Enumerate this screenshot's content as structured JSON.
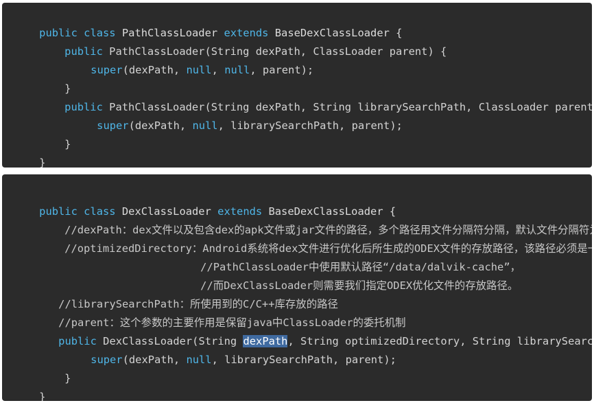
{
  "block1": {
    "lines": [
      {
        "indent": "",
        "parts": [
          {
            "t": "public class ",
            "c": "kw"
          },
          {
            "t": "PathClassLoader ",
            "c": "cls"
          },
          {
            "t": "extends ",
            "c": "kw"
          },
          {
            "t": "BaseDexClassLoader {",
            "c": "cls"
          }
        ]
      },
      {
        "indent": "    ",
        "parts": [
          {
            "t": "public ",
            "c": "kw"
          },
          {
            "t": "PathClassLoader(String dexPath, ClassLoader parent) {",
            "c": "plain"
          }
        ]
      },
      {
        "indent": "        ",
        "parts": [
          {
            "t": "super",
            "c": "kw"
          },
          {
            "t": "(dexPath, ",
            "c": "plain"
          },
          {
            "t": "null",
            "c": "kw"
          },
          {
            "t": ", ",
            "c": "plain"
          },
          {
            "t": "null",
            "c": "kw"
          },
          {
            "t": ", parent);",
            "c": "plain"
          }
        ]
      },
      {
        "indent": "    ",
        "parts": [
          {
            "t": "}",
            "c": "plain"
          }
        ]
      },
      {
        "indent": "    ",
        "parts": [
          {
            "t": "public ",
            "c": "kw"
          },
          {
            "t": "PathClassLoader(String dexPath, String librarySearchPath, ClassLoader parent) {",
            "c": "plain"
          }
        ]
      },
      {
        "indent": "         ",
        "parts": [
          {
            "t": "super",
            "c": "kw"
          },
          {
            "t": "(dexPath, ",
            "c": "plain"
          },
          {
            "t": "null",
            "c": "kw"
          },
          {
            "t": ", librarySearchPath, parent);",
            "c": "plain"
          }
        ]
      },
      {
        "indent": "    ",
        "parts": [
          {
            "t": "}",
            "c": "plain"
          }
        ]
      },
      {
        "indent": "",
        "parts": [
          {
            "t": "}",
            "c": "plain"
          }
        ]
      }
    ]
  },
  "block2": {
    "lines": [
      {
        "indent": "",
        "parts": [
          {
            "t": "public class ",
            "c": "kw"
          },
          {
            "t": "DexClassLoader ",
            "c": "cls"
          },
          {
            "t": "extends ",
            "c": "kw"
          },
          {
            "t": "BaseDexClassLoader {",
            "c": "cls"
          }
        ]
      },
      {
        "indent": "    ",
        "parts": [
          {
            "t": "//dexPath：dex文件以及包含dex的apk文件或jar文件的路径，多个路径用文件分隔符分隔，默认文件分隔符为‘:’",
            "c": "comment"
          }
        ]
      },
      {
        "indent": "    ",
        "parts": [
          {
            "t": "//optimizedDirectory：Android系统将dex文件进行优化后所生成的ODEX文件的存放路径，该路径必须是一个内部存储路径",
            "c": "comment"
          }
        ]
      },
      {
        "indent": "                         ",
        "parts": [
          {
            "t": "//PathClassLoader中使用默认路径“/data/dalvik-cache”，",
            "c": "comment"
          }
        ]
      },
      {
        "indent": "                         ",
        "parts": [
          {
            "t": "//而DexClassLoader则需要我们指定ODEX优化文件的存放路径。",
            "c": "comment"
          }
        ]
      },
      {
        "indent": "   ",
        "parts": [
          {
            "t": "//librarySearchPath：所使用到的C/C++库存放的路径",
            "c": "comment"
          }
        ]
      },
      {
        "indent": "   ",
        "parts": [
          {
            "t": "//parent：这个参数的主要作用是保留java中ClassLoader的委托机制",
            "c": "comment"
          }
        ]
      },
      {
        "indent": "   ",
        "parts": [
          {
            "t": "public ",
            "c": "kw"
          },
          {
            "t": "DexClassLoader(String ",
            "c": "plain"
          },
          {
            "t": "dexPath",
            "c": "hl"
          },
          {
            "t": ", String optimizedDirectory, String librarySearchPath, ClassLoader parent) {",
            "c": "plain"
          }
        ]
      },
      {
        "indent": "        ",
        "parts": [
          {
            "t": "super",
            "c": "kw"
          },
          {
            "t": "(dexPath, ",
            "c": "plain"
          },
          {
            "t": "null",
            "c": "kw"
          },
          {
            "t": ", librarySearchPath, parent);",
            "c": "plain"
          }
        ]
      },
      {
        "indent": "    ",
        "parts": [
          {
            "t": "}",
            "c": "plain"
          }
        ]
      },
      {
        "indent": "",
        "parts": [
          {
            "t": "}",
            "c": "plain"
          }
        ]
      }
    ]
  },
  "colors": {
    "background": "#2b2b2b",
    "keyword": "#4fb6e8",
    "text": "#d4d4d4",
    "selection": "#3f6aa0"
  }
}
